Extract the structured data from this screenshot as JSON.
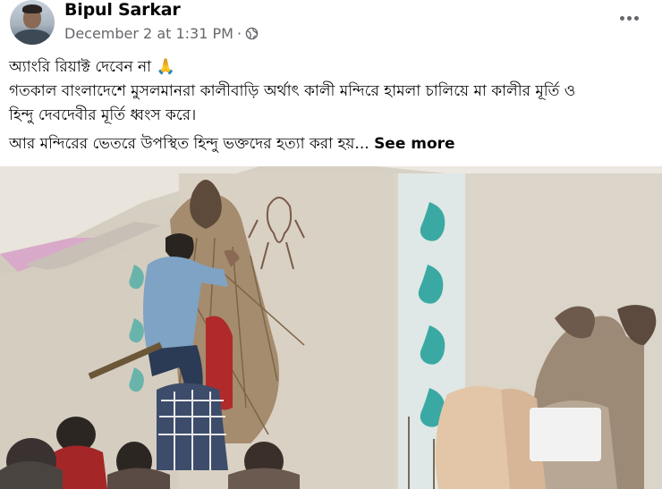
{
  "post": {
    "author_name": "Bipul Sarkar",
    "timestamp": "December 2 at 1:31 PM",
    "separator": "·",
    "privacy_icon": "globe-icon",
    "more_icon": "ellipsis-icon",
    "line1": "অ্যাংরি রিয়াক্ট দেবেন না 🙏",
    "line2": "গতকাল বাংলাদেশে মুসলমানরা কালীবাড়ি অর্থাৎ কালী মন্দিরে হামলা চালিয়ে মা কালীর মূর্তি ও",
    "line3": "হিন্দু দেবদেবীর মূর্তি ধ্বংস করে।",
    "line4": "আর মন্দিরের ভেতরে উপস্থিত হিন্দু ভক্তদের হত্যা করা হয়...",
    "see_more": "See more"
  },
  "colors": {
    "text_primary": "#050505",
    "text_secondary": "#65676b",
    "wall": "#d7d1c5",
    "paisley_teal": "#3aa9a3",
    "shirt_blue": "#7fa3c4"
  }
}
